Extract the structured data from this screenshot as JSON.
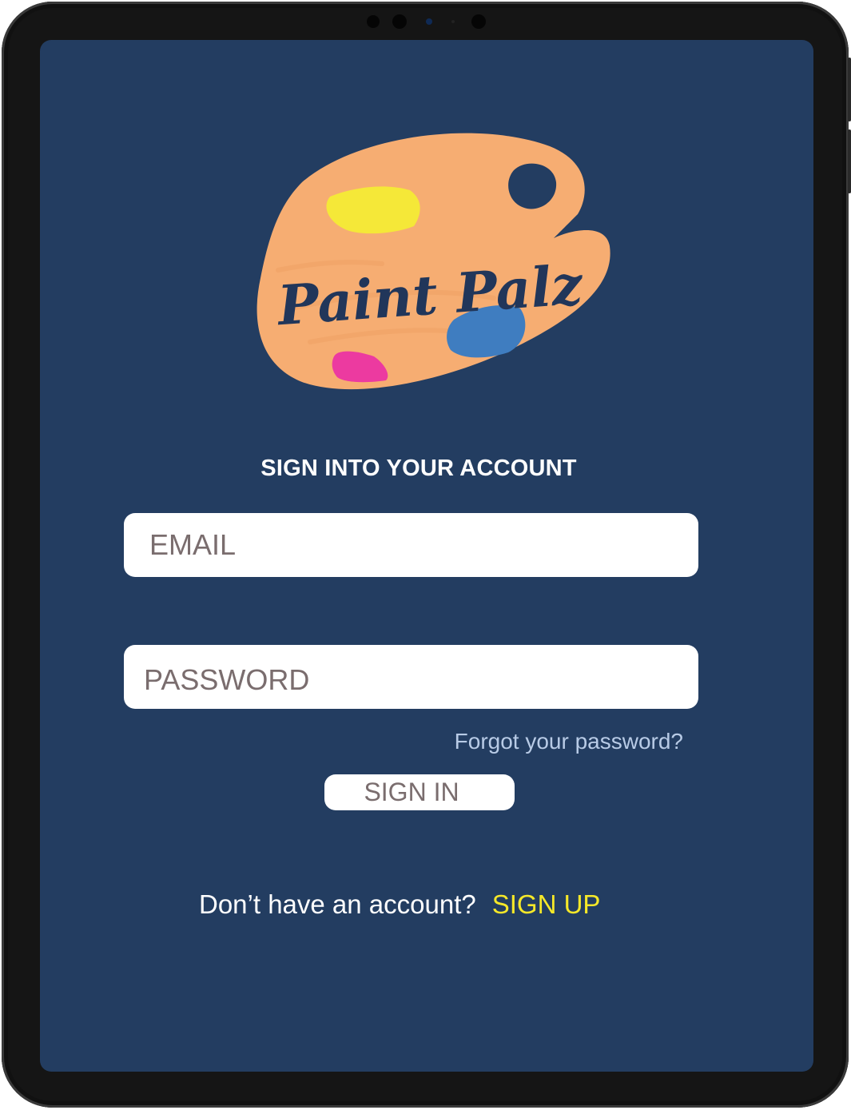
{
  "logo": {
    "text": "Paint Palz",
    "colors": {
      "palette": "#f6ad72",
      "yellow": "#f5e838",
      "blue": "#3f7dc0",
      "pink": "#ec3aa0",
      "lettering": "#21365a"
    }
  },
  "form": {
    "title": "SIGN INTO YOUR ACCOUNT",
    "email": {
      "placeholder": "EMAIL",
      "value": ""
    },
    "password": {
      "placeholder": "PASSWORD",
      "value": ""
    },
    "forgot_label": "Forgot your password?",
    "signin_label": "SIGN IN"
  },
  "signup": {
    "prompt": "Don’t have an account?",
    "link_label": "SIGN UP"
  },
  "colors": {
    "screen_background": "#233d61",
    "link_yellow": "#f5e829",
    "forgot_link": "#b8cbe6"
  }
}
